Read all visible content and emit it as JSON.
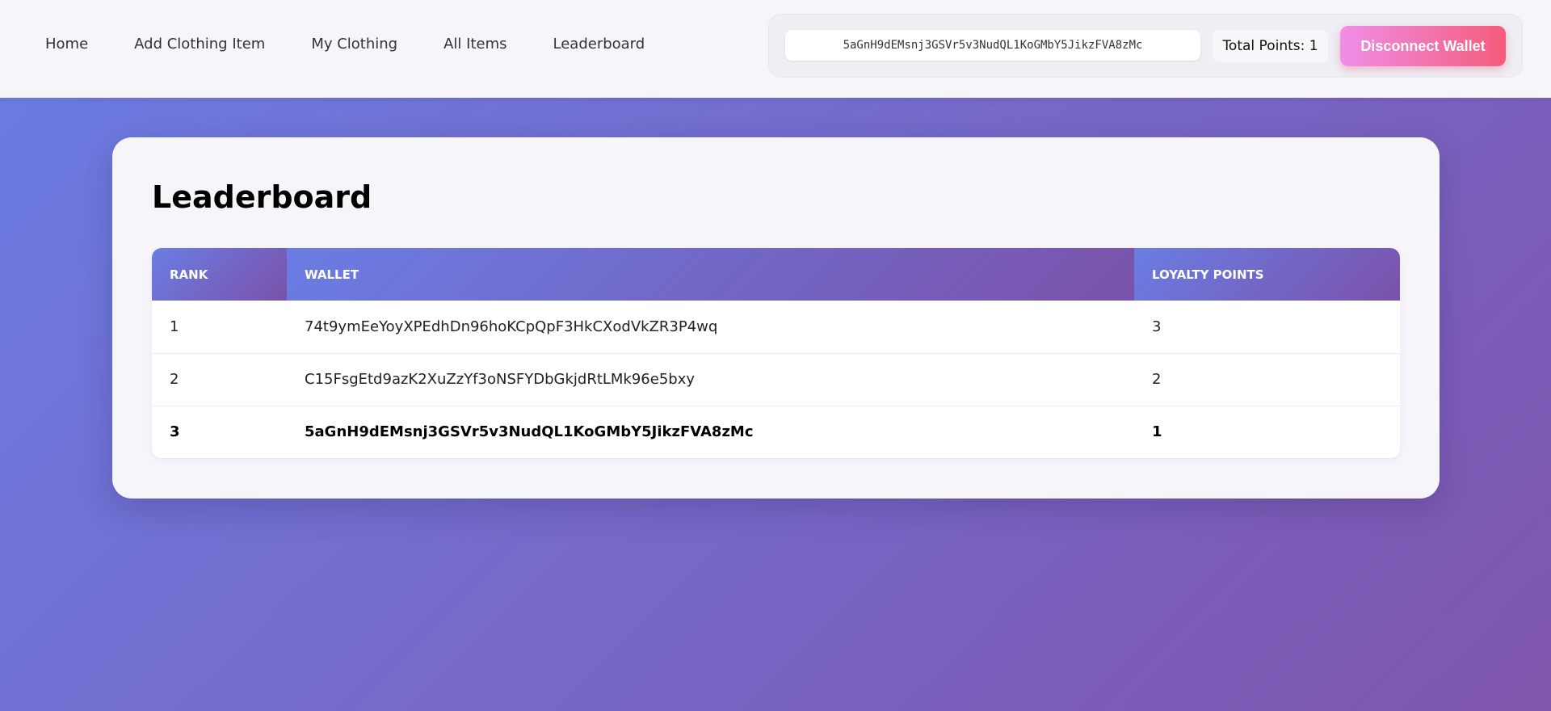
{
  "nav": {
    "links": [
      "Home",
      "Add Clothing Item",
      "My Clothing",
      "All Items",
      "Leaderboard"
    ]
  },
  "wallet": {
    "address": "5aGnH9dEMsnj3GSVr5v3NudQL1KoGMbY5JikzFVA8zMc",
    "total_points": "Total Points: 1",
    "disconnect_label": "Disconnect Wallet"
  },
  "leaderboard": {
    "title": "Leaderboard",
    "columns": [
      "RANK",
      "WALLET",
      "LOYALTY POINTS"
    ],
    "rows": [
      {
        "rank": "1",
        "wallet": "74t9ymEeYoyXPEdhDn96hoKCpQpF3HkCXodVkZR3P4wq",
        "points": "3"
      },
      {
        "rank": "2",
        "wallet": "C15FsgEtd9azK2XuZzYf3oNSFYDbGkjdRtLMk96e5bxy",
        "points": "2"
      },
      {
        "rank": "3",
        "wallet": "5aGnH9dEMsnj3GSVr5v3NudQL1KoGMbY5JikzFVA8zMc",
        "points": "1"
      }
    ]
  },
  "colors": {
    "accent_start": "#6a7de3",
    "accent_end": "#7f55ad",
    "button_start": "#f08ee8",
    "button_end": "#f45c7a"
  }
}
